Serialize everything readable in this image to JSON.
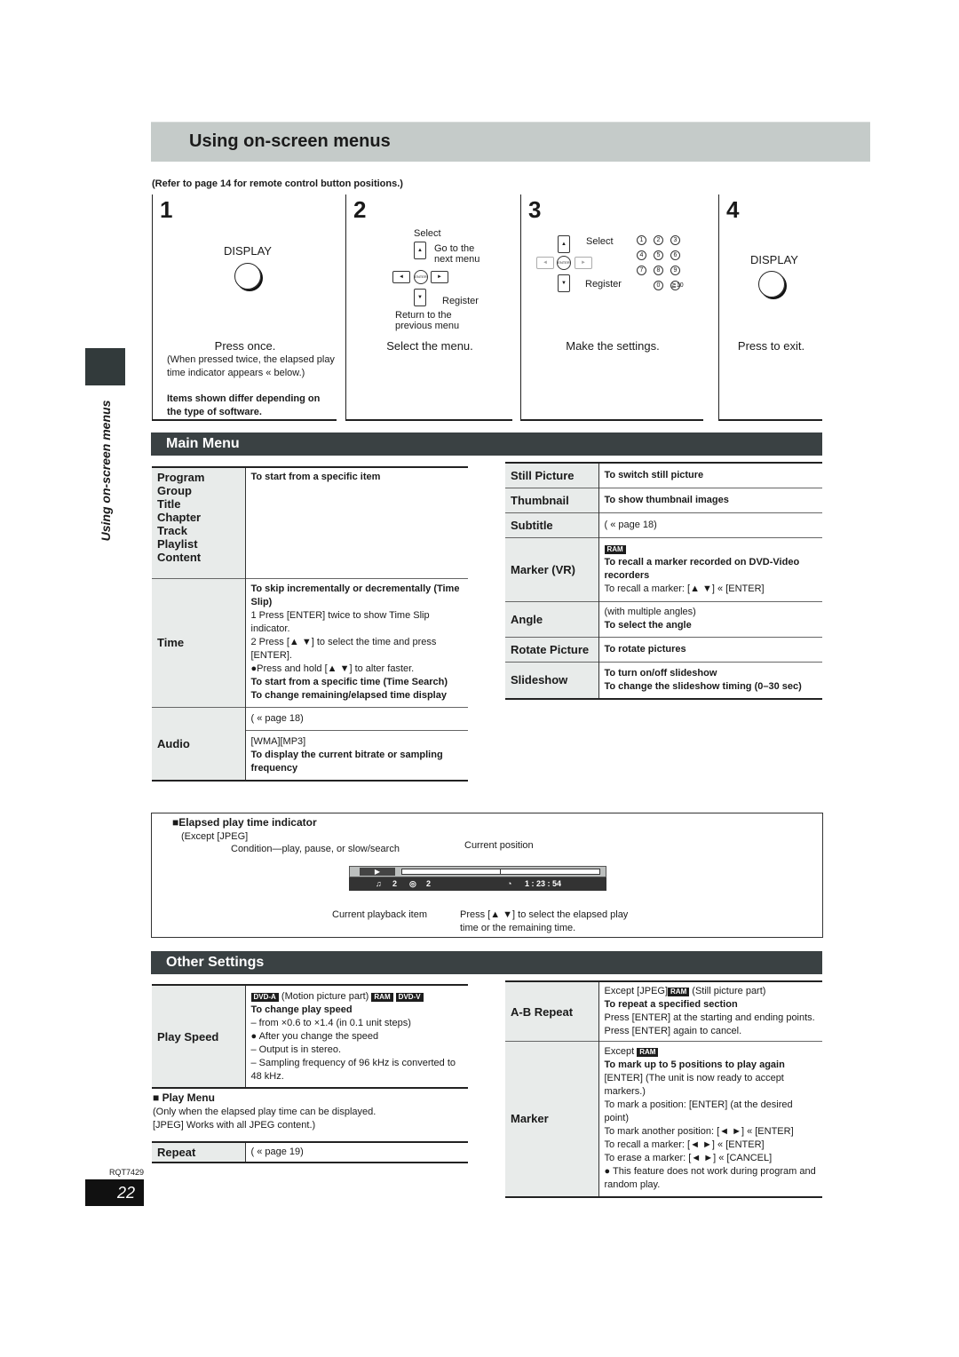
{
  "header": {
    "title": "Using on-screen menus",
    "refer_note": "(Refer to page 14 for remote control button positions.)"
  },
  "side_tab": "Using on-screen menus",
  "steps": [
    {
      "num": "1",
      "button": "DISPLAY",
      "caption": "Press once.",
      "note": "(When pressed twice, the elapsed play time indicator appears « below.)",
      "note_bold": "Items shown differ depending on the type of software."
    },
    {
      "num": "2",
      "labels": {
        "select": "Select",
        "next": "Go to the next menu",
        "register": "Register",
        "previous": "Return to the previous menu"
      },
      "caption": "Select the menu."
    },
    {
      "num": "3",
      "labels": {
        "select": "Select",
        "register": "Register"
      },
      "numkeys": [
        "1",
        "2",
        "3",
        "4",
        "5",
        "6",
        "7",
        "8",
        "9",
        "0",
        "≧10"
      ],
      "caption": "Make the settings."
    },
    {
      "num": "4",
      "button": "DISPLAY",
      "caption": "Press to exit."
    }
  ],
  "main_menu": {
    "title": "Main Menu",
    "left": [
      {
        "keys": [
          "Program",
          "Group",
          "Title",
          "Chapter",
          "Track",
          "Playlist",
          "Content"
        ],
        "lines": [
          {
            "t": "To start from a specific item",
            "b": true
          }
        ]
      },
      {
        "keys": [
          "Time"
        ],
        "lines": [
          {
            "t": "To skip incrementally or decrementally (Time Slip)",
            "b": true
          },
          {
            "t": "1  Press [ENTER] twice to show Time Slip indicator.",
            "b": false
          },
          {
            "t": "2  Press [▲ ▼] to select the time and press [ENTER].",
            "b": false
          },
          {
            "t": "●Press and hold [▲ ▼] to alter faster.",
            "b": false
          },
          {
            "t": "To start from a specific time (Time Search)",
            "b": true
          },
          {
            "t": "To change remaining/elapsed time display",
            "b": true
          }
        ]
      },
      {
        "keys": [
          "Audio"
        ],
        "sub": [
          [
            {
              "t": "( « page 18)",
              "b": false
            }
          ],
          [
            {
              "t": "[WMA][MP3]",
              "b": false
            },
            {
              "t": "To display the current bitrate or sampling frequency",
              "b": true
            }
          ]
        ]
      }
    ],
    "right": [
      {
        "key": "Still Picture",
        "lines": [
          {
            "t": "To switch still picture",
            "b": true
          }
        ]
      },
      {
        "key": "Thumbnail",
        "lines": [
          {
            "t": "To show thumbnail images",
            "b": true
          }
        ]
      },
      {
        "key": "Subtitle",
        "lines": [
          {
            "t": "( « page 18)",
            "b": false
          }
        ]
      },
      {
        "key": "Marker (VR)",
        "badge": "RAM",
        "lines": [
          {
            "t": "To recall a marker recorded on DVD-Video recorders",
            "b": true
          },
          {
            "t": "To recall a marker: [▲ ▼]  « [ENTER]",
            "b": false
          }
        ]
      },
      {
        "key": "Angle",
        "lines": [
          {
            "t": "(with multiple angles)",
            "b": false
          },
          {
            "t": "To select the angle",
            "b": true
          }
        ]
      },
      {
        "key": "Rotate Picture",
        "lines": [
          {
            "t": "To rotate pictures",
            "b": true
          }
        ]
      },
      {
        "key": "Slideshow",
        "lines": [
          {
            "t": "To turn on/off slideshow",
            "b": true
          },
          {
            "t": "To change the slideshow timing (0–30 sec)",
            "b": true
          }
        ]
      }
    ]
  },
  "elapsed": {
    "title": "■Elapsed play time indicator",
    "except": "(Except [JPEG]",
    "condition_label": "Condition—play, pause, or slow/search",
    "position_label": "Current position",
    "playback_label": "Current playback item",
    "select_label": "Press [▲ ▼] to select the elapsed play time or the remaining time.",
    "osd": {
      "item1": "2",
      "item2": "2",
      "time": "1 : 23 : 54",
      "progress": 0.5
    }
  },
  "other_settings": {
    "title": "Other Settings",
    "play_speed": {
      "key": "Play Speed",
      "badges": [
        "DVD-A",
        "RAM",
        "DVD-V"
      ],
      "badge_note": "(Motion picture part)",
      "lines": [
        {
          "t": "To change play speed",
          "b": true
        },
        {
          "t": "– from ×0.6 to ×1.4 (in 0.1 unit steps)",
          "b": false
        },
        {
          "t": "● After you change the speed",
          "b": false
        },
        {
          "t": "– Output is in stereo.",
          "b": false
        },
        {
          "t": "– Sampling frequency of 96 kHz is converted to 48 kHz.",
          "b": false
        }
      ]
    },
    "play_menu": {
      "title": "■  Play Menu",
      "note1": "(Only when the elapsed play time can be displayed.",
      "note2": "[JPEG] Works with all JPEG content.)"
    },
    "repeat": {
      "key": "Repeat",
      "value": "( « page 19)"
    },
    "ab_repeat": {
      "key": "A-B Repeat",
      "except": "Except [JPEG]",
      "badge": "RAM",
      "after": "(Still picture part)",
      "lines": [
        {
          "t": "To repeat a specified section",
          "b": true
        },
        {
          "t": "Press [ENTER] at the starting and ending points. Press [ENTER] again to cancel.",
          "b": false
        }
      ]
    },
    "marker": {
      "key": "Marker",
      "except": "Except",
      "badge": "RAM",
      "lines": [
        {
          "t": "To mark up to 5 positions to play again",
          "b": true
        },
        {
          "t": "[ENTER] (The unit is now ready to accept markers.)",
          "b": false
        },
        {
          "t": "To mark a position: [ENTER] (at the desired point)",
          "b": false
        },
        {
          "t": "To mark another position:  [◄ ►]  « [ENTER]",
          "b": false
        },
        {
          "t": "To recall a marker:  [◄ ►]  « [ENTER]",
          "b": false
        },
        {
          "t": "To erase a marker:  [◄ ►]  « [CANCEL]",
          "b": false
        },
        {
          "t": "● This feature does not work during program and random play.",
          "b": false
        }
      ]
    }
  },
  "footer": {
    "code": "RQT7429",
    "page": "22"
  }
}
